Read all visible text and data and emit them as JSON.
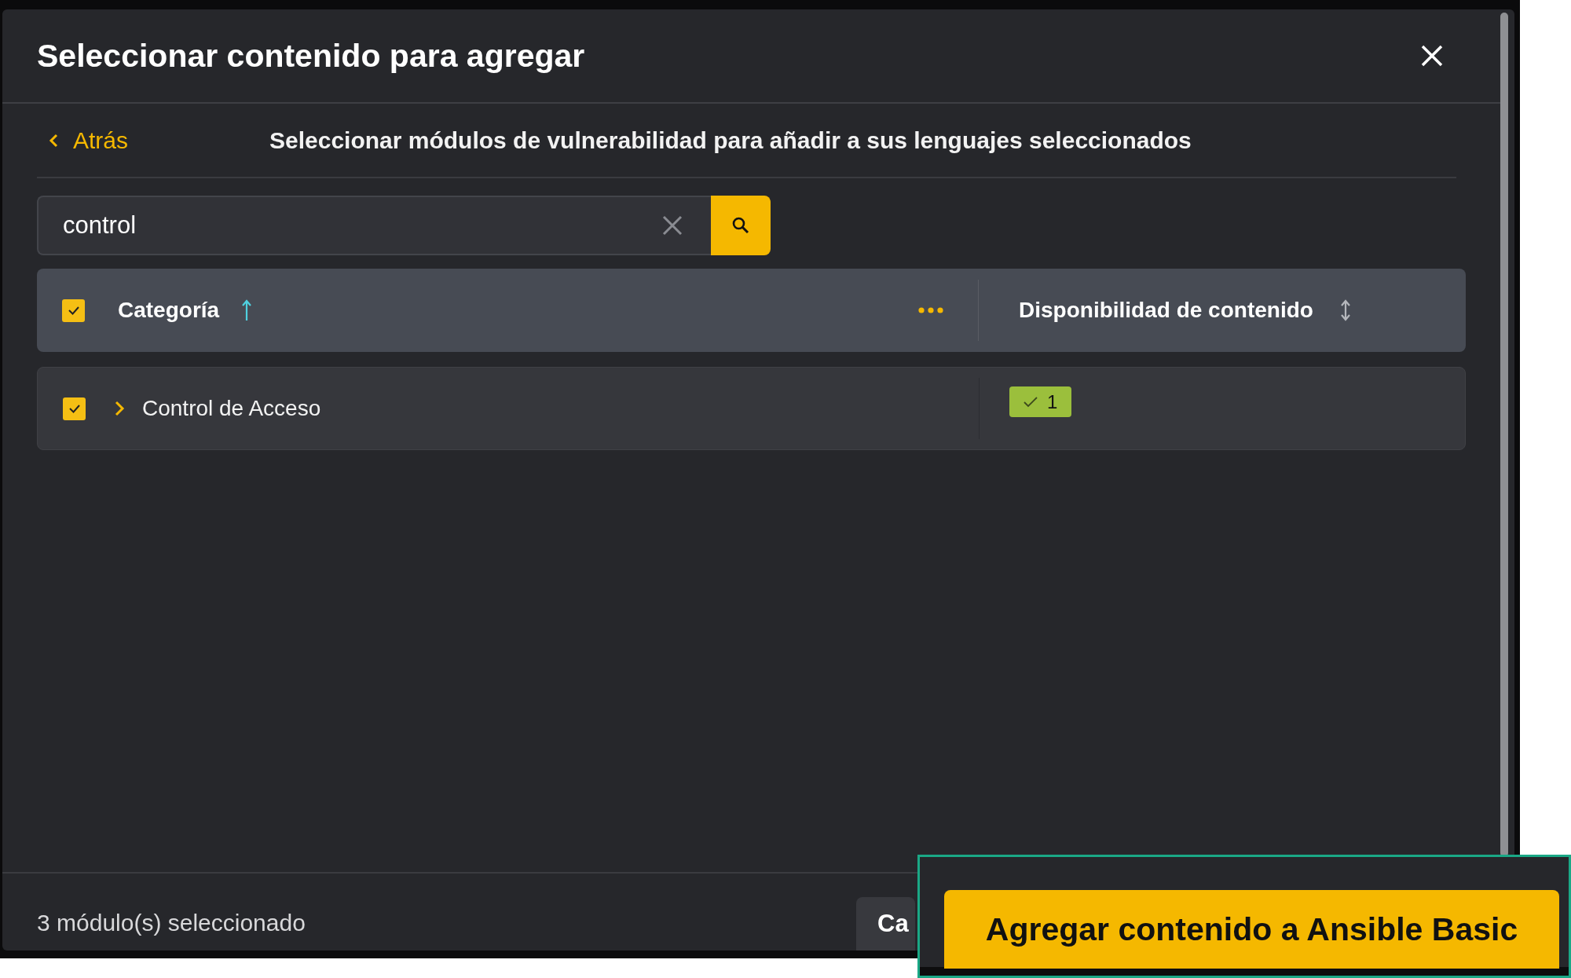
{
  "dialog": {
    "title": "Seleccionar contenido para agregar"
  },
  "navigation": {
    "back_label": "Atrás",
    "subtitle": "Seleccionar módulos de vulnerabilidad para añadir a sus lenguajes seleccionados"
  },
  "search": {
    "value": "control"
  },
  "table": {
    "select_all_checked": true,
    "columns": [
      {
        "label": "Categoría",
        "sorted": true,
        "descending": false
      },
      {
        "label": "Disponibilidad de contenido",
        "sorted": false
      }
    ],
    "rows": [
      {
        "checked": true,
        "expanded": false,
        "name": "Control de Acceso",
        "availability": "1"
      }
    ]
  },
  "footer": {
    "selection_count": "3 módulo(s) seleccionado",
    "cancel_button": "Ca"
  },
  "callout": {
    "button": "Agregar contenido a Ansible Basic"
  }
}
